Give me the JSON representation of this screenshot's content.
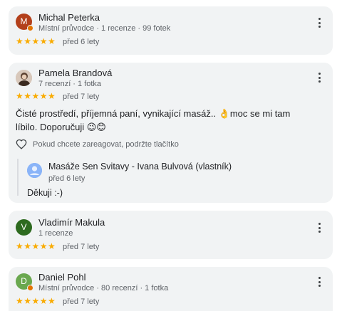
{
  "reviews": [
    {
      "name": "Michal Peterka",
      "avatar_letter": "M",
      "avatar_color": "#b3401b",
      "meta": "Místní průvodce · 1 recenze · 99 fotek",
      "stars": "★★★★★",
      "rating": 5,
      "date": "před 6 lety"
    },
    {
      "name": "Pamela Brandová",
      "meta": "7 recenzí · 1 fotka",
      "stars": "★★★★★",
      "rating": 5,
      "date": "před 7 lety",
      "text": "Čisté prostředí, příjemná paní, vynikající masáž.. 👌moc se mi tam líbilo. Doporučuji 😉😊",
      "react_label": "Pokud chcete zareagovat, podržte tlačítko",
      "reply": {
        "name": "Masáže Sen Svitavy - Ivana Bulvová (vlastník)",
        "date": "před 6 lety",
        "text": "Děkuji :-)"
      }
    },
    {
      "name": "Vladimír Makula",
      "avatar_letter": "V",
      "avatar_color": "#2d6a1f",
      "meta": "1 recenze",
      "stars": "★★★★★",
      "rating": 5,
      "date": "před 7 lety"
    },
    {
      "name": "Daniel Pohl",
      "avatar_letter": "D",
      "avatar_color": "#6aa84f",
      "meta": "Místní průvodce · 80 recenzí · 1 fotka",
      "stars": "★★★★★",
      "rating": 5,
      "date": "před 7 lety"
    }
  ]
}
